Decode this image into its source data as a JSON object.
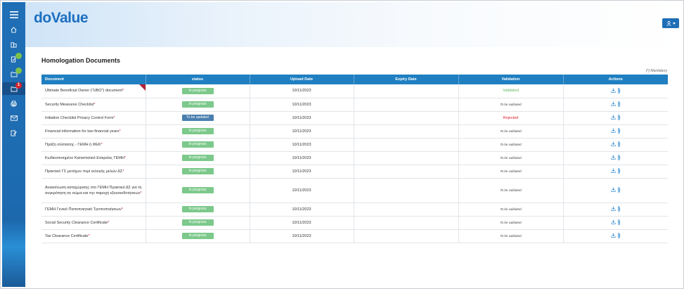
{
  "app": {
    "logo": "doValue",
    "colors": {
      "primary": "#1f6fb6",
      "header": "#1f7fc1",
      "progress": "#7cc98b",
      "to_be_updated": "#4a7fae",
      "validated": "#5cb85c",
      "rejected": "#d9232d"
    }
  },
  "sidebar": {
    "items": [
      {
        "icon": "menu-icon"
      },
      {
        "icon": "home-icon"
      },
      {
        "icon": "buildings-icon"
      },
      {
        "icon": "document-check-icon",
        "badge": ""
      },
      {
        "icon": "folder-check-icon",
        "badge": ""
      },
      {
        "icon": "folder-alert-icon",
        "badge": "1"
      },
      {
        "icon": "printer-icon"
      },
      {
        "icon": "mail-icon"
      },
      {
        "icon": "edit-document-icon"
      }
    ]
  },
  "header": {
    "user_icon": "user-icon",
    "dropdown_icon": "caret-down-icon"
  },
  "page": {
    "title": "Homologation Documents",
    "mandatory_note": "(*) Mandatory"
  },
  "table": {
    "columns": [
      "Document",
      "status",
      "Upload Date",
      "Expiry Date",
      "Validation",
      "Actions"
    ],
    "rows": [
      {
        "document": "Ultimate Beneficial Owner (\"UBO\") document",
        "status": "In progress",
        "upload": "10/11/2023",
        "expiry": "",
        "validation": "Validated",
        "vtype": "ok",
        "flag": true
      },
      {
        "document": "Security Measures Checklist",
        "status": "In progress",
        "upload": "10/11/2023",
        "expiry": "",
        "validation": "To be validated",
        "vtype": "tbv"
      },
      {
        "document": "Initiation Checklist Privacy Control Form",
        "status": "To be updated",
        "upload": "10/11/2023",
        "expiry": "",
        "validation": "Rejected",
        "vtype": "rej"
      },
      {
        "document": "Financial information for two financial years",
        "status": "In progress",
        "upload": "10/11/2023",
        "expiry": "",
        "validation": "To be validated",
        "vtype": "tbv"
      },
      {
        "document": "Πράξη σύστασης - ΓΕΜΗ ή ΦΕΚ",
        "status": "In progress",
        "upload": "10/11/2023",
        "expiry": "",
        "validation": "To be validated",
        "vtype": "tbv"
      },
      {
        "document": "Κωδικοποιημένο Καταστατικό Εταιρείας ΓΕΜΗ",
        "status": "In progress",
        "upload": "10/11/2023",
        "expiry": "",
        "validation": "To be validated",
        "vtype": "tbv"
      },
      {
        "document": "Πρακτικό ΓΣ μετόχων περί εκλογής μελών ΔΣ",
        "status": "In progress",
        "upload": "10/11/2023",
        "expiry": "",
        "validation": "To be validated",
        "vtype": "tbv"
      },
      {
        "document": "Ανακοίνωση καταχώρισης στο ΓΕΜΗ Πρακτικό ΔΣ για τη συγκρότηση σε σώμα και την παροχή εξουσιοδοτήσεων",
        "status": "In progress",
        "upload": "10/11/2023",
        "expiry": "",
        "validation": "To be validated",
        "vtype": "tbv",
        "tall": true
      },
      {
        "document": "ΓΕΜΗ Γενικό Πιστοποιητικό Τροποποιήσεων",
        "status": "In progress",
        "upload": "10/11/2023",
        "expiry": "",
        "validation": "To be validated",
        "vtype": "tbv"
      },
      {
        "document": "Social Security Clearance Certificate",
        "status": "In progress",
        "upload": "10/11/2023",
        "expiry": "",
        "validation": "To be validated",
        "vtype": "tbv"
      },
      {
        "document": "Tax Clearance Certificate",
        "status": "In progress",
        "upload": "10/11/2023",
        "expiry": "",
        "validation": "To be validated",
        "vtype": "tbv"
      }
    ],
    "required_mark": "*",
    "action_icons": [
      "download-icon",
      "paperclip-icon"
    ]
  }
}
